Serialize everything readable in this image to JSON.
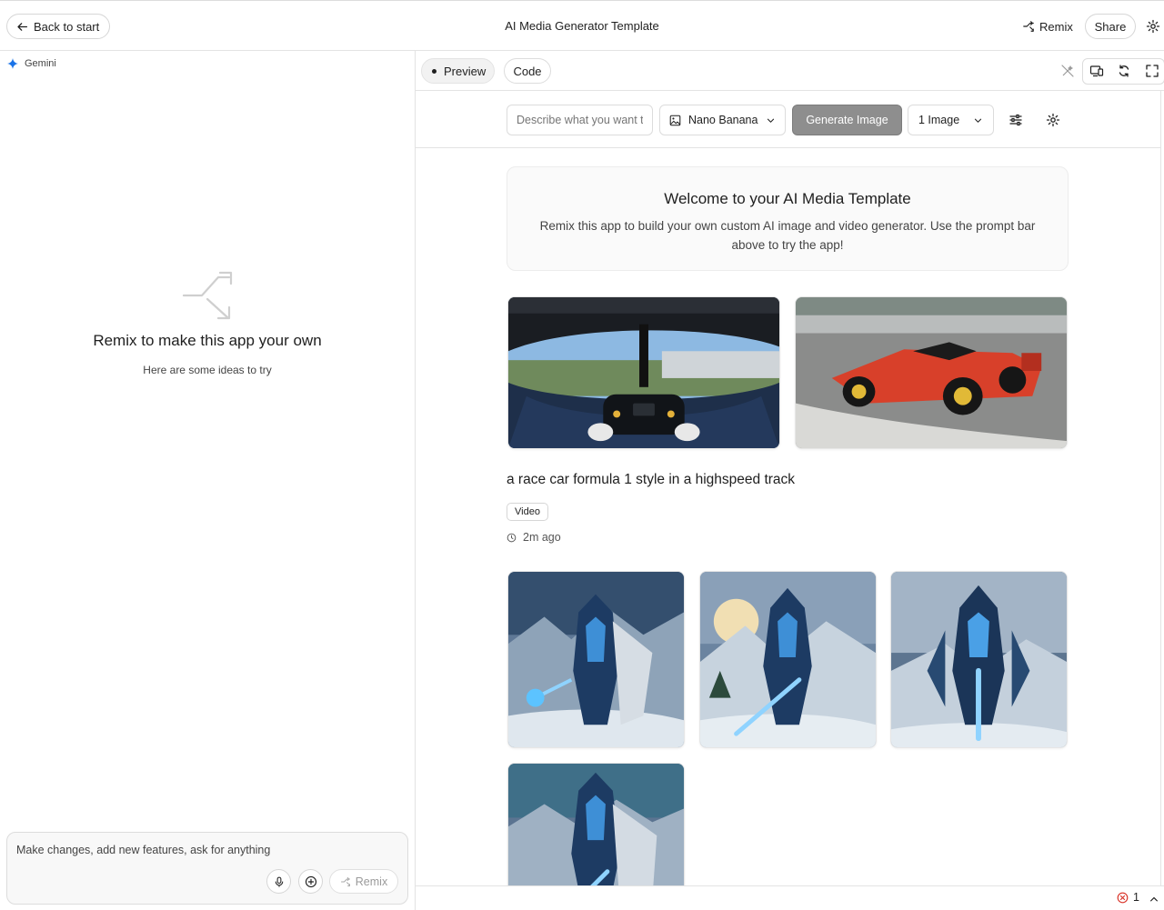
{
  "topbar": {
    "back_label": "Back to start",
    "title": "AI Media Generator Template",
    "remix_label": "Remix",
    "share_label": "Share"
  },
  "left": {
    "model_name": "Gemini",
    "empty_title": "Remix to make this app your own",
    "empty_subtitle": "Here are some ideas to try",
    "chat_placeholder": "Make changes, add new features, ask for anything",
    "send_label": "Remix"
  },
  "right": {
    "tabs": [
      {
        "label": "Preview",
        "active": true
      },
      {
        "label": "Code",
        "active": false
      }
    ],
    "toolbar_icons": [
      "magic-wand-off-icon",
      "device-icon",
      "refresh-icon",
      "fullscreen-icon"
    ]
  },
  "app": {
    "prompt_placeholder": "Describe what you want to create...",
    "model_select": "Nano Banana",
    "generate_label": "Generate  Image",
    "count_select": "1 Image",
    "welcome_title": "Welcome to your AI Media Template",
    "welcome_body": "Remix this app to build your own custom AI image and video generator. Use the prompt bar above to try the app!",
    "generation": {
      "prompt": "a race car formula 1 style in a highspeed track",
      "type": "Video",
      "time": "2m ago"
    }
  },
  "status": {
    "error_count": "1"
  },
  "colors": {
    "accent_gemini": "#1a73e8",
    "generate_button": "#8e8e8e",
    "error": "#d93025"
  }
}
